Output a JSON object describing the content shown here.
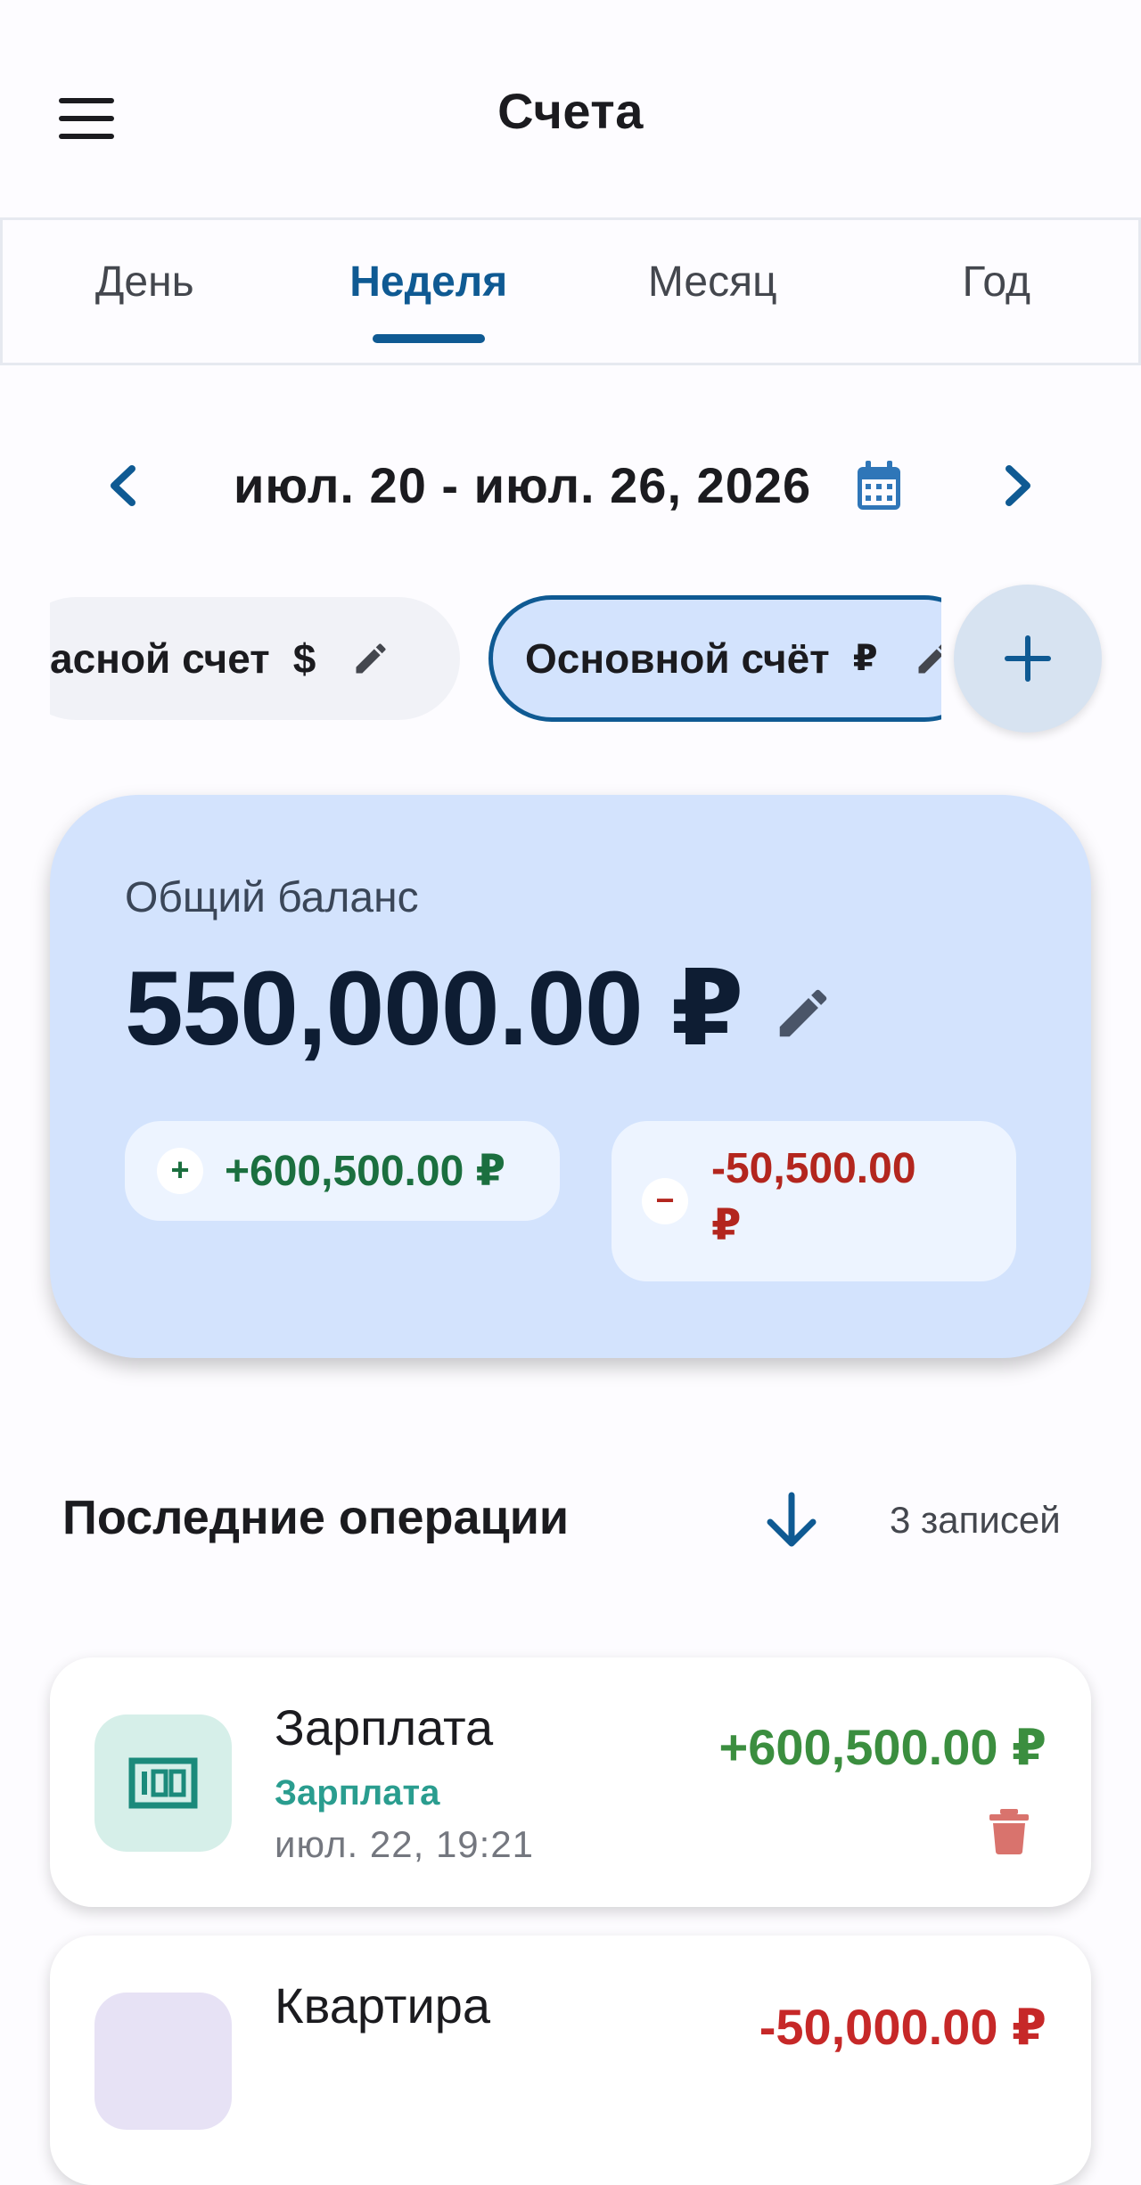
{
  "header": {
    "title": "Счета",
    "menu_icon": "menu-icon"
  },
  "tabs": [
    {
      "label": "День",
      "active": false
    },
    {
      "label": "Неделя",
      "active": true
    },
    {
      "label": "Месяц",
      "active": false
    },
    {
      "label": "Год",
      "active": false
    }
  ],
  "date_range": {
    "label": "июл. 20 - июл. 26, 2026"
  },
  "accounts": [
    {
      "name": "асной счет",
      "currency": "$",
      "selected": false
    },
    {
      "name": "Основной счёт",
      "currency": "₽",
      "selected": true
    }
  ],
  "balance": {
    "label": "Общий баланс",
    "amount": "550,000.00 ₽",
    "income": "+600,500.00 ₽",
    "expense_line1": "-50,500.00",
    "expense_line2": "₽",
    "income_sign": "+",
    "expense_sign": "−"
  },
  "operations": {
    "title": "Последние операции",
    "count": "3 записей",
    "items": [
      {
        "title": "Зарплата",
        "category": "Зарплата",
        "date": "июл. 22, 19:21",
        "amount": "+600,500.00 ₽",
        "type": "income",
        "icon": "money-icon"
      },
      {
        "title": "Квартира",
        "category": "",
        "date": "",
        "amount": "-50,000.00 ₽",
        "type": "expense",
        "icon": "home-icon"
      }
    ]
  },
  "colors": {
    "primary": "#0f5a93",
    "card_bg": "#d3e3fd",
    "income": "#1b6f3f",
    "expense": "#b3261e",
    "op_income": "#3b8e3f",
    "op_expense": "#c62828"
  }
}
